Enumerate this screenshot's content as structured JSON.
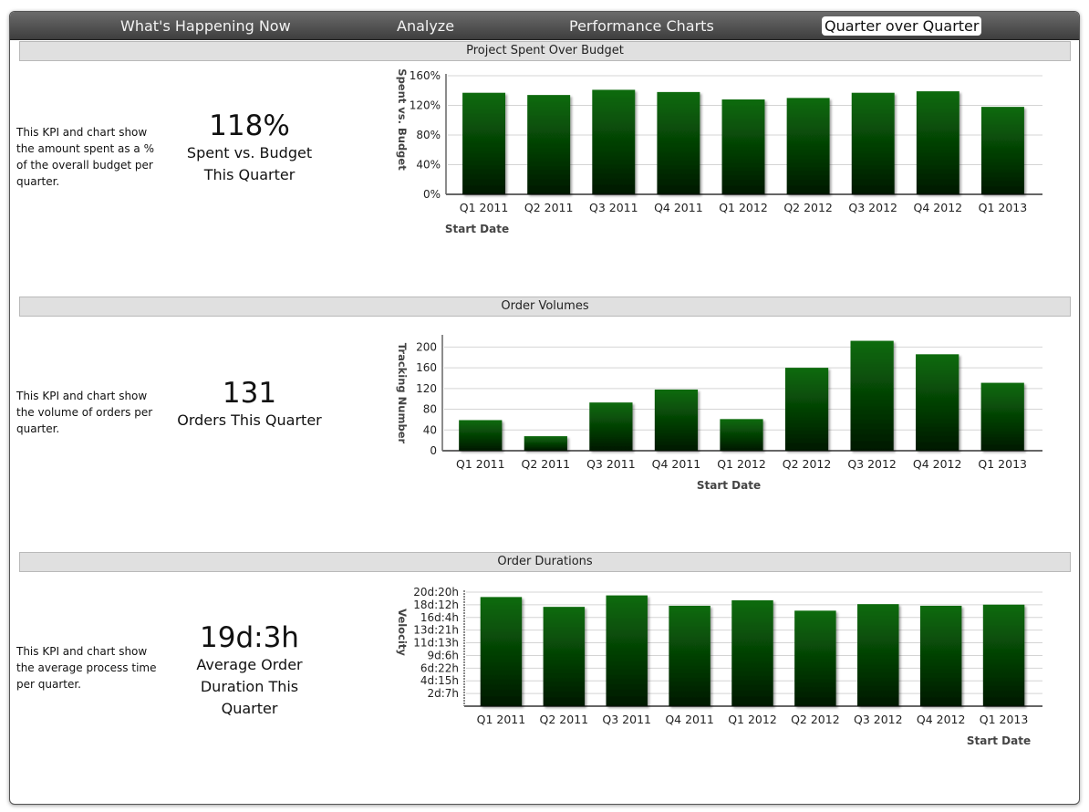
{
  "nav": {
    "tabs": [
      {
        "label": "What's Happening Now",
        "active": false
      },
      {
        "label": "Analyze",
        "active": false
      },
      {
        "label": "Performance Charts",
        "active": false
      },
      {
        "label": "Quarter over Quarter",
        "active": true
      }
    ]
  },
  "sections": [
    {
      "header": "Project Spent Over Budget",
      "description": "This KPI and chart show the amount spent as a % of the overall budget per quarter.",
      "kpi_value": "118%",
      "kpi_caption": "Spent vs. Budget This Quarter"
    },
    {
      "header": "Order Volumes",
      "description": "This KPI and chart show the volume of orders per quarter.",
      "kpi_value": "131",
      "kpi_caption": "Orders This Quarter"
    },
    {
      "header": "Order Durations",
      "description": "This KPI and chart show the average process time per quarter.",
      "kpi_value": "19d:3h",
      "kpi_caption": "Average Order Duration This Quarter"
    }
  ],
  "colors": {
    "bar_top": "#0b6b0b",
    "bar_bottom": "#001800",
    "gridline": "#d4d4d4",
    "axis": "#555555"
  },
  "chart_data": [
    {
      "type": "bar",
      "categories": [
        "Q1 2011",
        "Q2 2011",
        "Q3 2011",
        "Q4 2011",
        "Q1 2012",
        "Q2 2012",
        "Q3 2012",
        "Q4 2012",
        "Q1 2013"
      ],
      "values": [
        137,
        134,
        141,
        138,
        128,
        130,
        137,
        139,
        118
      ],
      "ylim": [
        0,
        160
      ],
      "yticks": [
        "0%",
        "40%",
        "80%",
        "120%",
        "160%"
      ],
      "xlabel": "Start Date",
      "ylabel": "Spent vs. Budget",
      "grid": true
    },
    {
      "type": "bar",
      "categories": [
        "Q1 2011",
        "Q2 2011",
        "Q3 2011",
        "Q4 2011",
        "Q1 2012",
        "Q2 2012",
        "Q3 2012",
        "Q4 2012",
        "Q1 2013"
      ],
      "values": [
        59,
        28,
        93,
        118,
        61,
        160,
        212,
        186,
        131
      ],
      "ylim": [
        0,
        220
      ],
      "yticks": [
        "0",
        "40",
        "80",
        "120",
        "160",
        "200"
      ],
      "xlabel": "Start Date",
      "ylabel": "Tracking Number",
      "grid": true
    },
    {
      "type": "bar",
      "categories": [
        "Q1 2011",
        "Q2 2011",
        "Q3 2011",
        "Q4 2011",
        "Q1 2012",
        "Q2 2012",
        "Q3 2012",
        "Q4 2012",
        "Q1 2013"
      ],
      "values": [
        20.0,
        18.2,
        20.3,
        18.4,
        19.4,
        17.5,
        18.7,
        18.4,
        18.6
      ],
      "ylim": [
        0,
        20.9
      ],
      "yticks": [
        "2d:7h",
        "4d:15h",
        "6d:22h",
        "9d:6h",
        "11d:13h",
        "13d:21h",
        "16d:4h",
        "18d:12h",
        "20d:20h"
      ],
      "xlabel": "Start Date",
      "ylabel": "Velocity",
      "grid": true
    }
  ]
}
